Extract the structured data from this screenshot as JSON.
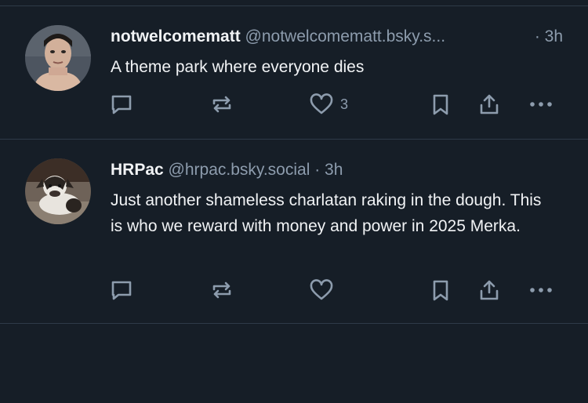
{
  "posts": [
    {
      "display_name": "notwelcomematt",
      "handle": "@notwelcomematt.bsky.s...",
      "time": "· 3h",
      "text": "A theme park where everyone dies",
      "like_count": "3",
      "avatar": "person-photo"
    },
    {
      "display_name": "HRPac",
      "handle": "@hrpac.bsky.social",
      "time": "· 3h",
      "text": "Just another shameless charlatan raking in the dough. This is who we reward with money and power in 2025 Merka.",
      "like_count": "",
      "avatar": "dog-photo"
    }
  ],
  "icons": {
    "reply": "speech-bubble-icon",
    "repost": "repost-arrows-icon",
    "like": "heart-icon",
    "bookmark": "bookmark-icon",
    "share": "share-upload-icon",
    "more": "ellipsis-icon"
  },
  "colors": {
    "background": "#161e27",
    "divider": "#2e3a48",
    "primary_text": "#f1f3f5",
    "secondary_text": "#8d9cad"
  }
}
